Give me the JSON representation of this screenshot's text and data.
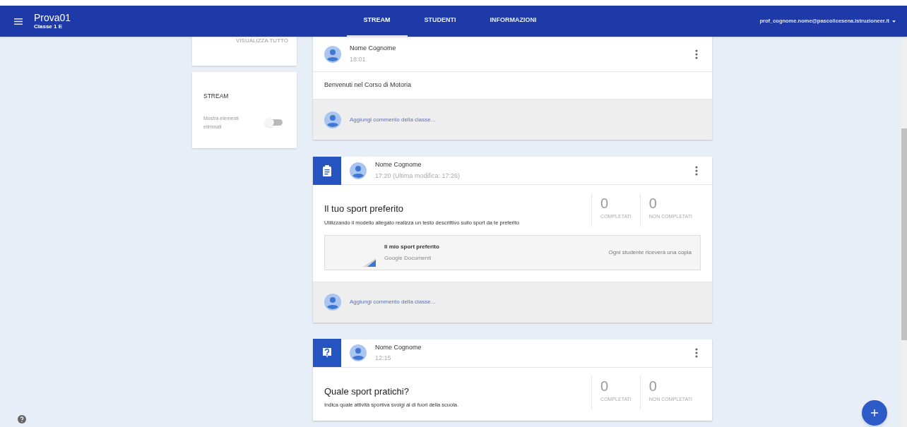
{
  "header": {
    "course": "Prova01",
    "section": "Classe 1 E",
    "account": "prof_cognome.nome@pascolicesena.istruzioneer.it"
  },
  "tabs": [
    {
      "label": "STREAM",
      "selected": true
    },
    {
      "label": "STUDENTI",
      "selected": false
    },
    {
      "label": "INFORMAZIONI",
      "selected": false
    }
  ],
  "sidebar": {
    "view_all": "VISUALIZZA TUTTO",
    "stream_title": "STREAM",
    "toggle": {
      "label": "Mostra elementi eliminati",
      "on": false
    }
  },
  "posts": [
    {
      "kind": "announcement",
      "author": "Nome Cognome",
      "time": "18:01",
      "text": "Benvenuti nel Corso di Motoria",
      "comment_placeholder": "Aggiungi commento della classe..."
    },
    {
      "kind": "assignment",
      "author": "Nome Cognome",
      "time": "17:20 (Ultima modifica: 17:26)",
      "title": "Il tuo sport preferito",
      "description": "Utilizzando il modello allegato realizza un testo descrittivo sullo sport da te preferito",
      "stats": [
        {
          "value": "0",
          "label": "COMPLETATI"
        },
        {
          "value": "0",
          "label": "NON COMPLETATI"
        }
      ],
      "attachment": {
        "name": "Il mio sport preferito",
        "type": "Google Documenti",
        "note": "Ogni studente riceverà una copia"
      },
      "comment_placeholder": "Aggiungi commento della classe..."
    },
    {
      "kind": "question",
      "author": "Nome Cognome",
      "time": "12:15",
      "title": "Quale sport pratichi?",
      "description": "Indica quale attività sportiva svolgi al di fuori della scuola.",
      "stats": [
        {
          "value": "0",
          "label": "COMPLETATI"
        },
        {
          "value": "0",
          "label": "NON COMPLETATI"
        }
      ]
    }
  ]
}
